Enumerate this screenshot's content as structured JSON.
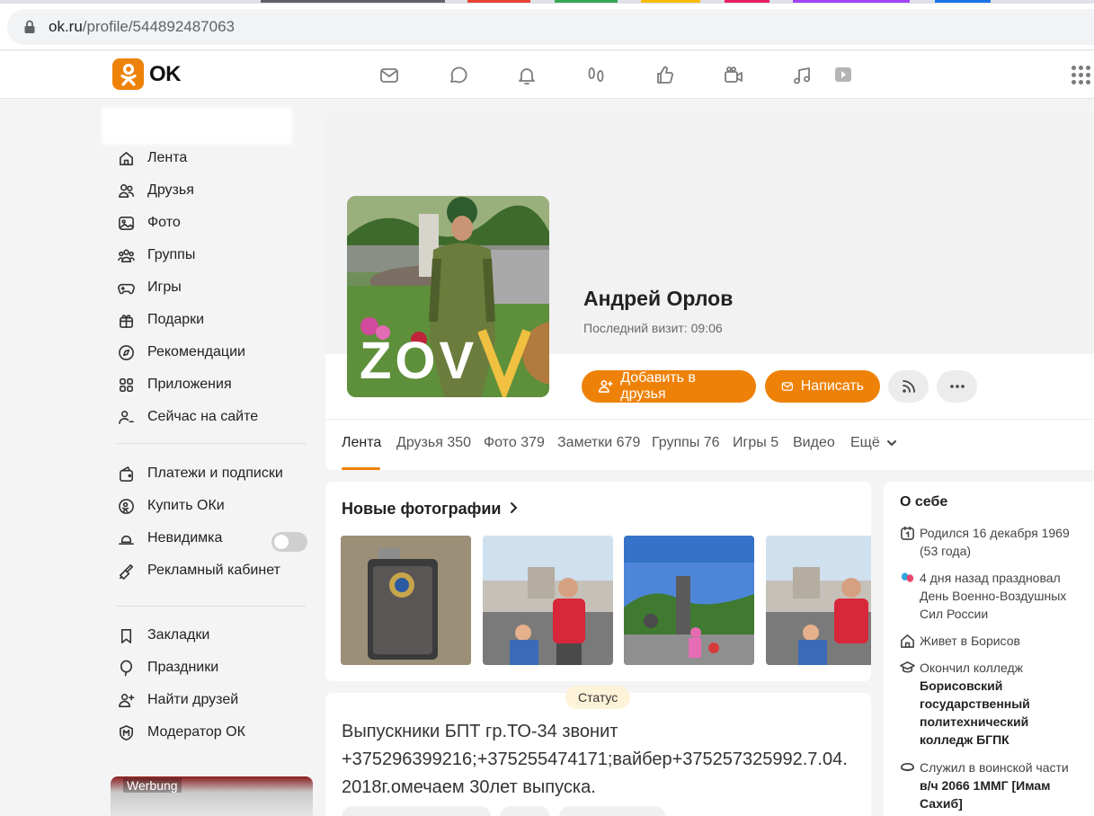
{
  "browser": {
    "url_host": "ok.ru",
    "url_path": "/profile/544892487063"
  },
  "brand": {
    "name": "OK",
    "accent": "#ee8208"
  },
  "topnav": [
    "mail-icon",
    "chat-icon",
    "bell-icon",
    "footprints-icon",
    "thumbs-up-icon",
    "video-icon",
    "music-icon",
    "play-icon"
  ],
  "sidebar": {
    "items": [
      {
        "label": "Лента",
        "icon": "home-icon"
      },
      {
        "label": "Друзья",
        "icon": "friends-icon"
      },
      {
        "label": "Фото",
        "icon": "photo-icon"
      },
      {
        "label": "Группы",
        "icon": "groups-icon"
      },
      {
        "label": "Игры",
        "icon": "gamepad-icon"
      },
      {
        "label": "Подарки",
        "icon": "gift-icon"
      },
      {
        "label": "Рекомендации",
        "icon": "compass-icon"
      },
      {
        "label": "Приложения",
        "icon": "apps-icon"
      },
      {
        "label": "Сейчас на сайте",
        "icon": "online-user-icon"
      }
    ],
    "items2": [
      {
        "label": "Платежи и подписки",
        "icon": "wallet-icon"
      },
      {
        "label": "Купить ОКи",
        "icon": "coin-icon"
      },
      {
        "label": "Невидимка",
        "icon": "invisible-icon"
      },
      {
        "label": "Рекламный кабинет",
        "icon": "megaphone-icon"
      }
    ],
    "items3": [
      {
        "label": "Закладки",
        "icon": "bookmark-icon"
      },
      {
        "label": "Праздники",
        "icon": "balloon-icon"
      },
      {
        "label": "Найти друзей",
        "icon": "add-user-icon"
      },
      {
        "label": "Модератор ОК",
        "icon": "moderator-icon"
      }
    ],
    "invisible_toggle_on": false,
    "ad_label": "Werbung"
  },
  "profile": {
    "name": "Андрей Орлов",
    "last_visit": "Последний визит: 09:06",
    "add_friend": "Добавить в друзья",
    "write": "Написать",
    "avatar_caption": "ZOV"
  },
  "tabs": [
    {
      "label": "Лента",
      "count": ""
    },
    {
      "label": "Друзья",
      "count": "350"
    },
    {
      "label": "Фото",
      "count": "379"
    },
    {
      "label": "Заметки",
      "count": "679"
    },
    {
      "label": "Группы",
      "count": "76"
    },
    {
      "label": "Игры",
      "count": "5"
    },
    {
      "label": "Видео",
      "count": ""
    },
    {
      "label": "Ещё",
      "count": ""
    }
  ],
  "photos": {
    "title": "Новые фотографии"
  },
  "status": {
    "badge": "Статус",
    "text": "Выпускники БПТ гр.ТО-34 звонит +375296399216;+375255474171;вайбер+375257325992.7.04. 2018г.омечаем 30лет выпуска."
  },
  "about": {
    "title": "О себе",
    "born": "Родился 16 декабря 1969 (53 года)",
    "holiday": "4 дня назад праздновал День Военно-Воздушных Сил России",
    "lives": "Живет в Борисов",
    "edu_prefix": "Окончил колледж",
    "edu_name": "Борисовский государственный политехнический колледж БГПК",
    "army_prefix": "Служил в воинской части",
    "army_name": "в/ч 2066 1ММГ [Имам Сахиб]"
  }
}
